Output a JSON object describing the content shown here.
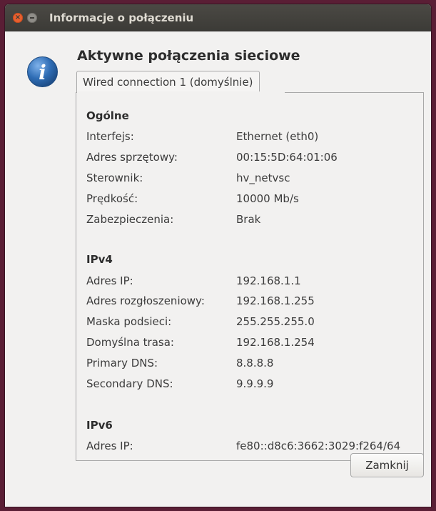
{
  "window": {
    "title": "Informacje o połączeniu"
  },
  "heading": "Aktywne połączenia sieciowe",
  "tab": {
    "label": "Wired connection 1 (domyślnie)"
  },
  "general": {
    "title": "Ogólne",
    "rows": [
      {
        "label": "Interfejs:",
        "value": "Ethernet (eth0)"
      },
      {
        "label": "Adres sprzętowy:",
        "value": "00:15:5D:64:01:06"
      },
      {
        "label": "Sterownik:",
        "value": "hv_netvsc"
      },
      {
        "label": "Prędkość:",
        "value": "10000 Mb/s"
      },
      {
        "label": "Zabezpieczenia:",
        "value": "Brak"
      }
    ]
  },
  "ipv4": {
    "title": "IPv4",
    "rows": [
      {
        "label": "Adres IP:",
        "value": "192.168.1.1"
      },
      {
        "label": "Adres rozgłoszeniowy:",
        "value": "192.168.1.255"
      },
      {
        "label": "Maska podsieci:",
        "value": "255.255.255.0"
      },
      {
        "label": "Domyślna trasa:",
        "value": "192.168.1.254"
      },
      {
        "label": "Primary DNS:",
        "value": "8.8.8.8"
      },
      {
        "label": "Secondary DNS:",
        "value": "9.9.9.9"
      }
    ]
  },
  "ipv6": {
    "title": "IPv6",
    "rows": [
      {
        "label": "Adres IP:",
        "value": "fe80::d8c6:3662:3029:f264/64"
      }
    ]
  },
  "buttons": {
    "close_label": "Zamknij"
  },
  "colors": {
    "accent": "#e9602f",
    "titlebar": "#3c3b37",
    "info_icon": "#2f6db5"
  }
}
